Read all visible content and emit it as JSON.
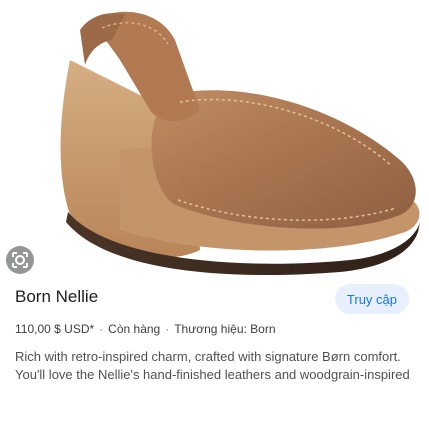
{
  "product": {
    "image_alt": "Born Nellie wedge sandal",
    "title": "Born Nellie",
    "visit_label": "Truy cập",
    "price": "110,00 $ USD*",
    "availability": "Còn hàng",
    "brand_label": "Thương hiệu:",
    "brand": "Born",
    "description": "Rich with retro-inspired charm, crafted with signature Børn comfort. You'll love the Nellie's hand-finished leathers and woodgrain-inspired"
  },
  "icons": {
    "lens": "google-lens-icon"
  },
  "colors": {
    "accent": "#1a73e8",
    "button_bg": "#e8f0fe",
    "leather": "#b9825a",
    "cork": "#c89a6c"
  }
}
